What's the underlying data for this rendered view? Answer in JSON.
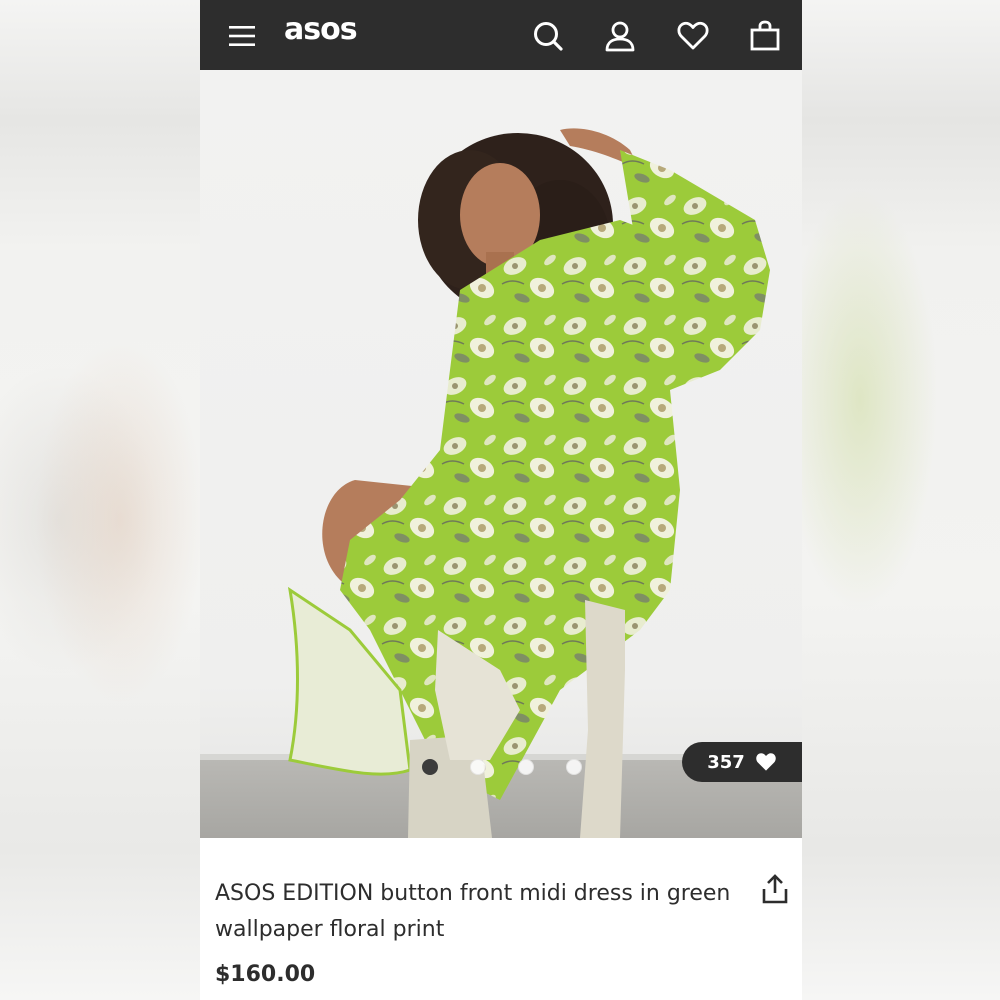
{
  "header": {
    "logo_text": "asos",
    "icons": [
      "menu-icon",
      "search-icon",
      "account-icon",
      "wishlist-icon",
      "bag-icon"
    ]
  },
  "product": {
    "image_alt": "ASOS EDITION button front midi dress in green wallpaper floral print",
    "likes_count": "357",
    "gallery_total": 4,
    "gallery_active_index": 0,
    "title": "ASOS EDITION button front midi dress in green wallpaper floral print",
    "price": "$160.00"
  },
  "colors": {
    "header_bg": "#2d2d2d",
    "text": "#2d2d2d",
    "dress_green": "#9ccb3a"
  }
}
